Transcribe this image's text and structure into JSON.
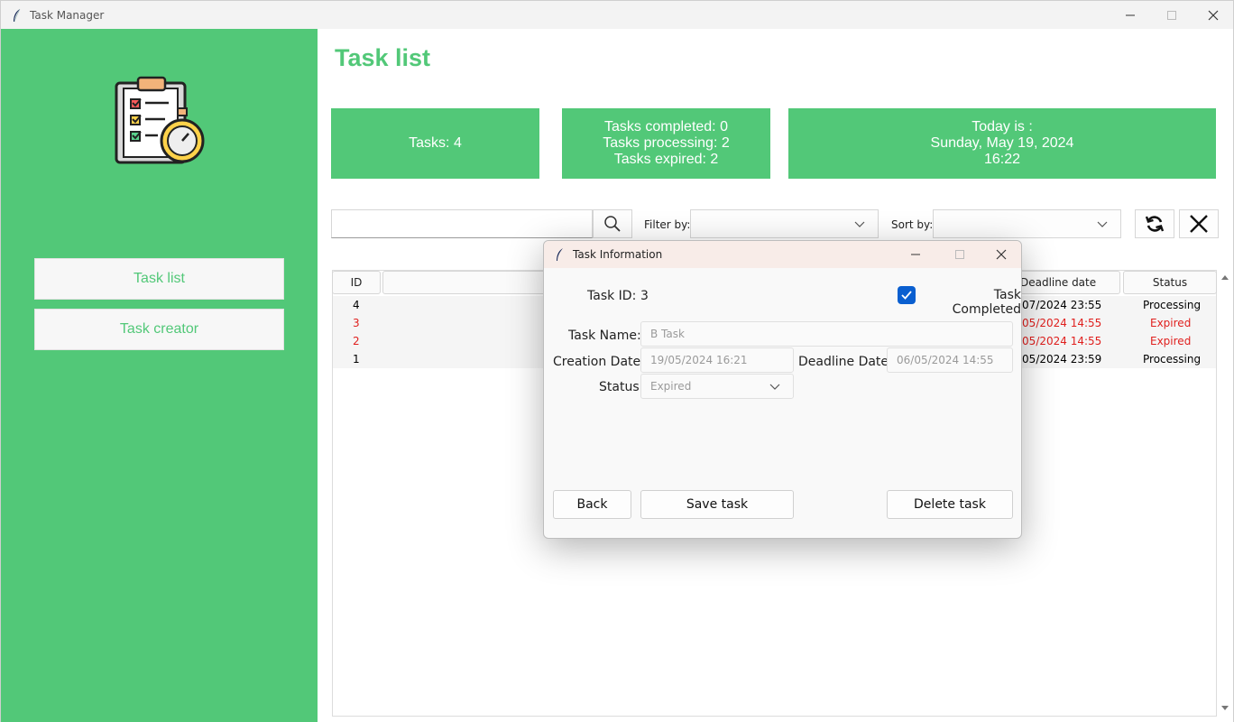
{
  "window": {
    "title": "Task Manager"
  },
  "sidebar": {
    "items": [
      {
        "label": "Task list"
      },
      {
        "label": "Task creator"
      }
    ]
  },
  "main": {
    "title": "Task list",
    "cards": {
      "tasks": "Tasks: 4",
      "completed": "Tasks completed: 0",
      "processing": "Tasks processing: 2",
      "expired": "Tasks expired: 2",
      "today_label": "Today is :",
      "today_date": "Sunday, May 19, 2024",
      "today_time": "16:22"
    },
    "toolbar": {
      "search_value": "",
      "filter_label": "Filter by:",
      "filter_value": "",
      "sort_label": "Sort by:",
      "sort_value": ""
    },
    "table": {
      "columns": [
        "ID",
        "",
        "Deadline date",
        "Status"
      ],
      "rows": [
        {
          "id": "4",
          "deadline": "/07/2024 23:55",
          "status": "Processing",
          "expired": false
        },
        {
          "id": "3",
          "deadline": "/05/2024 14:55",
          "status": "Expired",
          "expired": true
        },
        {
          "id": "2",
          "deadline": "/05/2024 14:55",
          "status": "Expired",
          "expired": true
        },
        {
          "id": "1",
          "deadline": "/05/2024 23:59",
          "status": "Processing",
          "expired": false
        }
      ]
    }
  },
  "dialog": {
    "title": "Task Information",
    "task_id_label": "Task ID:",
    "task_id": "3",
    "completed_label": "Task Completed",
    "completed": true,
    "name_label": "Task Name:",
    "name_value": "B Task",
    "creation_label": "Creation Date:",
    "creation_value": "19/05/2024 16:21",
    "deadline_label": "Deadline Date:",
    "deadline_value": "06/05/2024 14:55",
    "status_label": "Status:",
    "status_value": "Expired",
    "back_label": "Back",
    "save_label": "Save task",
    "delete_label": "Delete task"
  },
  "colors": {
    "accent": "#52c878",
    "expired": "#e0201e",
    "checkbox": "#0a5fd0"
  }
}
